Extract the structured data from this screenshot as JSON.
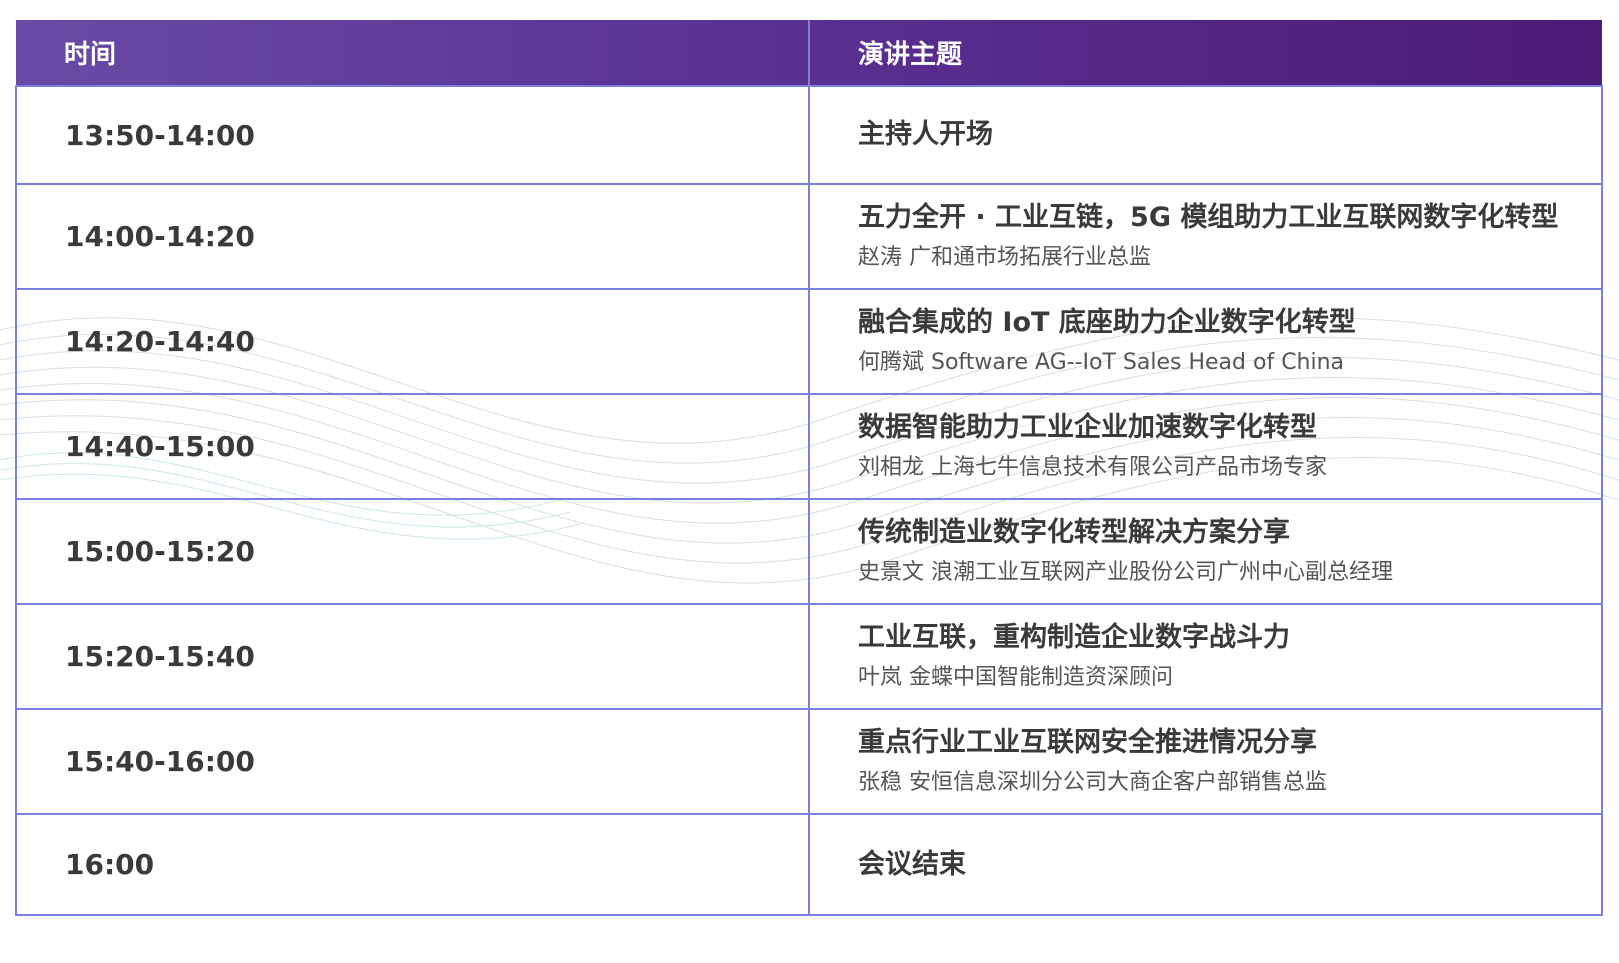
{
  "header": {
    "time_label": "时间",
    "topic_label": "演讲主题"
  },
  "rows": [
    {
      "time": "13:50-14:00",
      "title": "主持人开场",
      "speaker": ""
    },
    {
      "time": "14:00-14:20",
      "title": "五力全开 · 工业互链，5G 模组助力工业互联网数字化转型",
      "speaker": "赵涛 广和通市场拓展行业总监"
    },
    {
      "time": "14:20-14:40",
      "title": "融合集成的 IoT 底座助力企业数字化转型",
      "speaker": "何腾斌 Software AG--IoT Sales Head of China"
    },
    {
      "time": "14:40-15:00",
      "title": "数据智能助力工业企业加速数字化转型",
      "speaker": "刘相龙 上海七牛信息技术有限公司产品市场专家"
    },
    {
      "time": "15:00-15:20",
      "title": "传统制造业数字化转型解决方案分享",
      "speaker": "史景文 浪潮工业互联网产业股份公司广州中心副总经理"
    },
    {
      "time": "15:20-15:40",
      "title": "工业互联，重构制造企业数字战斗力",
      "speaker": "叶岚 金蝶中国智能制造资深顾问"
    },
    {
      "time": "15:40-16:00",
      "title": "重点行业工业互联网安全推进情况分享",
      "speaker": "张稳 安恒信息深圳分公司大商企客户部销售总监"
    },
    {
      "time": "16:00",
      "title": "会议结束",
      "speaker": ""
    }
  ],
  "colors": {
    "header_start": "#6a4aa6",
    "header_end": "#4e1a78",
    "grid_line": "#7b7fe0",
    "text_dark": "#3a3a3a"
  }
}
